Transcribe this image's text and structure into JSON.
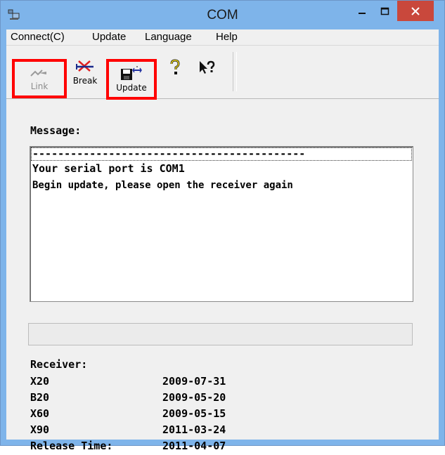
{
  "window": {
    "title": "COM"
  },
  "menu": [
    "Connect(C)",
    "Update",
    "Language",
    "Help"
  ],
  "toolbar": {
    "link_label": "Link",
    "break_label": "Break",
    "update_label": "Update"
  },
  "message": {
    "label": "Message:",
    "lines": [
      "-------------------------------------------",
      "Your serial port is COM1",
      "Begin update, please open the receiver again"
    ]
  },
  "progress": {
    "value": 0
  },
  "receiver": {
    "label": "Receiver:",
    "rows": [
      {
        "name": "X20",
        "date": "2009-07-31"
      },
      {
        "name": "B20",
        "date": "2009-05-20"
      },
      {
        "name": "X60",
        "date": "2009-05-15"
      },
      {
        "name": "X90",
        "date": "2011-03-24"
      },
      {
        "name": "Release Time:",
        "date": "2011-04-07"
      }
    ]
  },
  "colors": {
    "title_bar": "#7eb4ea",
    "close_button": "#c9483c",
    "highlight": "#ff0000"
  }
}
